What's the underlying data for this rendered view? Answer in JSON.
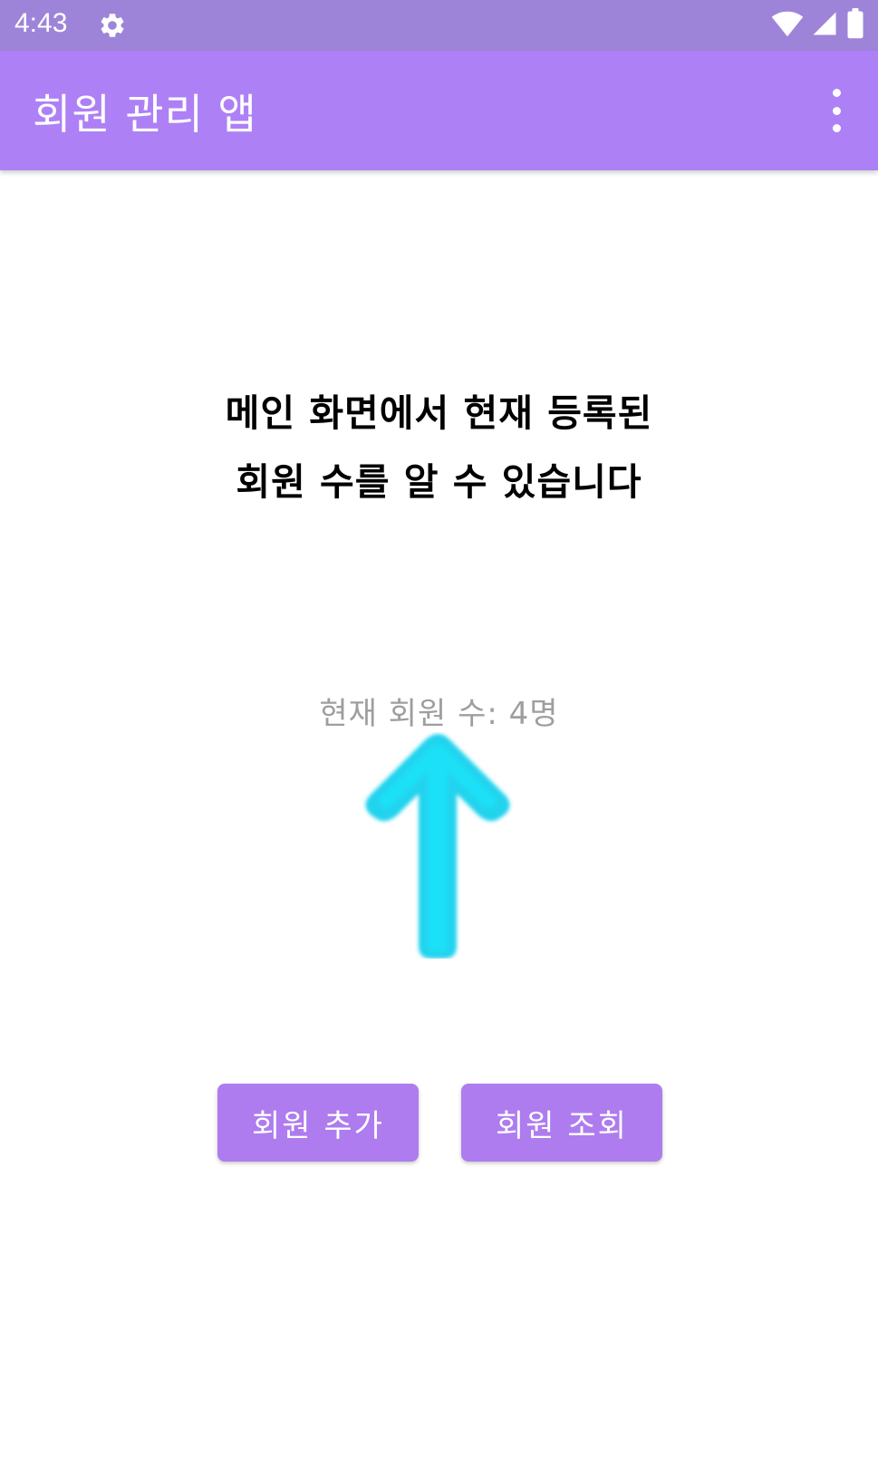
{
  "status_bar": {
    "time": "4:43",
    "background": "#9E84D9",
    "icons": [
      "gear-icon",
      "wifi-icon",
      "signal-icon",
      "battery-icon"
    ]
  },
  "app_bar": {
    "title": "회원 관리 앱",
    "background": "#AE80F5",
    "menu_icon": "more-vert-icon"
  },
  "main": {
    "instruction_lines": [
      "메인 화면에서 현재 등록된",
      "회원 수를 알 수 있습니다"
    ],
    "member_count_text": "현재 회원 수: 4명",
    "arrow_color": "#22D3EE",
    "buttons": {
      "add_label": "회원 추가",
      "view_label": "회원 조회",
      "background": "#AE7CEE"
    }
  }
}
